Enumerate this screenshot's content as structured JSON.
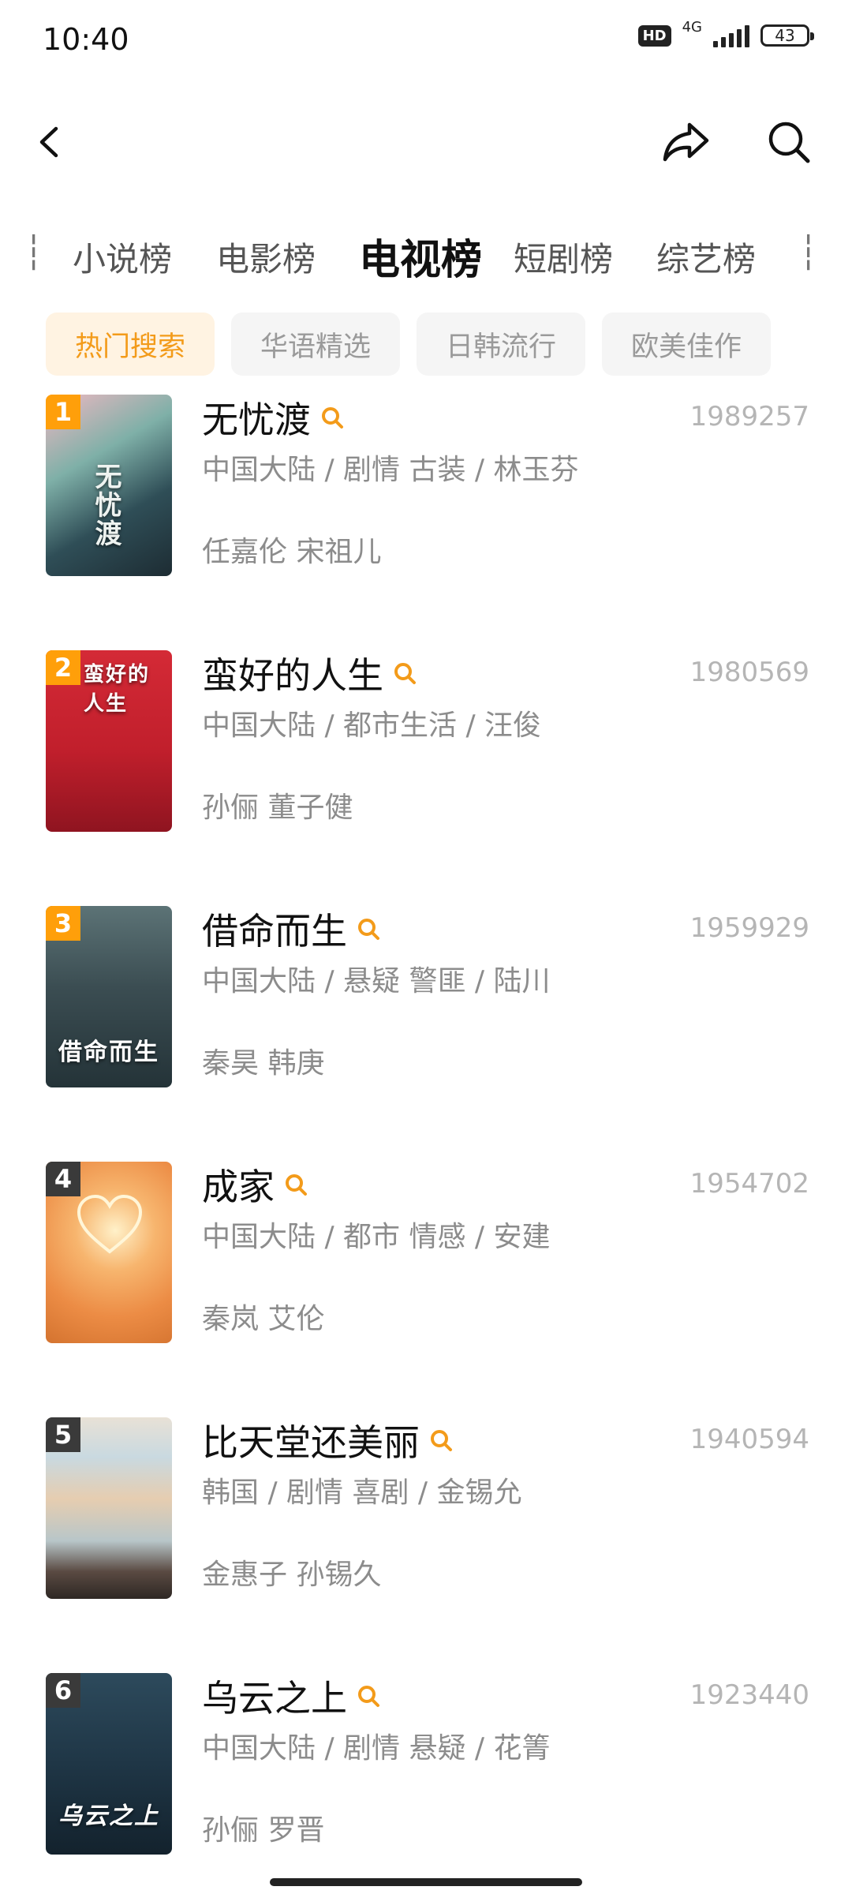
{
  "status_bar": {
    "time": "10:40",
    "hd": "HD",
    "network": "4G",
    "battery": "43"
  },
  "nav": {
    "back_icon": "chevron-left-icon",
    "share_icon": "share-icon",
    "search_icon": "search-icon"
  },
  "category_tabs": {
    "active": "电视榜",
    "items": [
      "小说榜",
      "电影榜",
      "电视榜",
      "短剧榜",
      "综艺榜"
    ]
  },
  "filter_chips": {
    "active": "热门搜索",
    "items": [
      "热门搜索",
      "华语精选",
      "日韩流行",
      "欧美佳作"
    ]
  },
  "colors": {
    "accent": "#f39b1a",
    "rank_badge_top3": "#ff9f0a",
    "rank_badge_other": "#3a3a3a"
  },
  "rank_list": [
    {
      "rank": "1",
      "title": "无忧渡",
      "meta": "中国大陆 / 剧情 古装 / 林玉芬",
      "cast": "任嘉伦 宋祖儿",
      "heat": "1989257",
      "poster_title": "无忧渡"
    },
    {
      "rank": "2",
      "title": "蛮好的人生",
      "meta": "中国大陆 / 都市生活 / 汪俊",
      "cast": "孙俪 董子健",
      "heat": "1980569",
      "poster_title": "蛮好的人生"
    },
    {
      "rank": "3",
      "title": "借命而生",
      "meta": "中国大陆 / 悬疑 警匪 / 陆川",
      "cast": "秦昊 韩庚",
      "heat": "1959929",
      "poster_title": "借命而生"
    },
    {
      "rank": "4",
      "title": "成家",
      "meta": "中国大陆 / 都市 情感 / 安建",
      "cast": "秦岚 艾伦",
      "heat": "1954702",
      "poster_title": ""
    },
    {
      "rank": "5",
      "title": "比天堂还美丽",
      "meta": "韩国 / 剧情 喜剧 / 金锡允",
      "cast": "金惠子 孙锡久",
      "heat": "1940594",
      "poster_title": ""
    },
    {
      "rank": "6",
      "title": "乌云之上",
      "meta": "中国大陆 / 剧情 悬疑 / 花箐",
      "cast": "孙俪 罗晋",
      "heat": "1923440",
      "poster_title": "乌云之上"
    }
  ]
}
